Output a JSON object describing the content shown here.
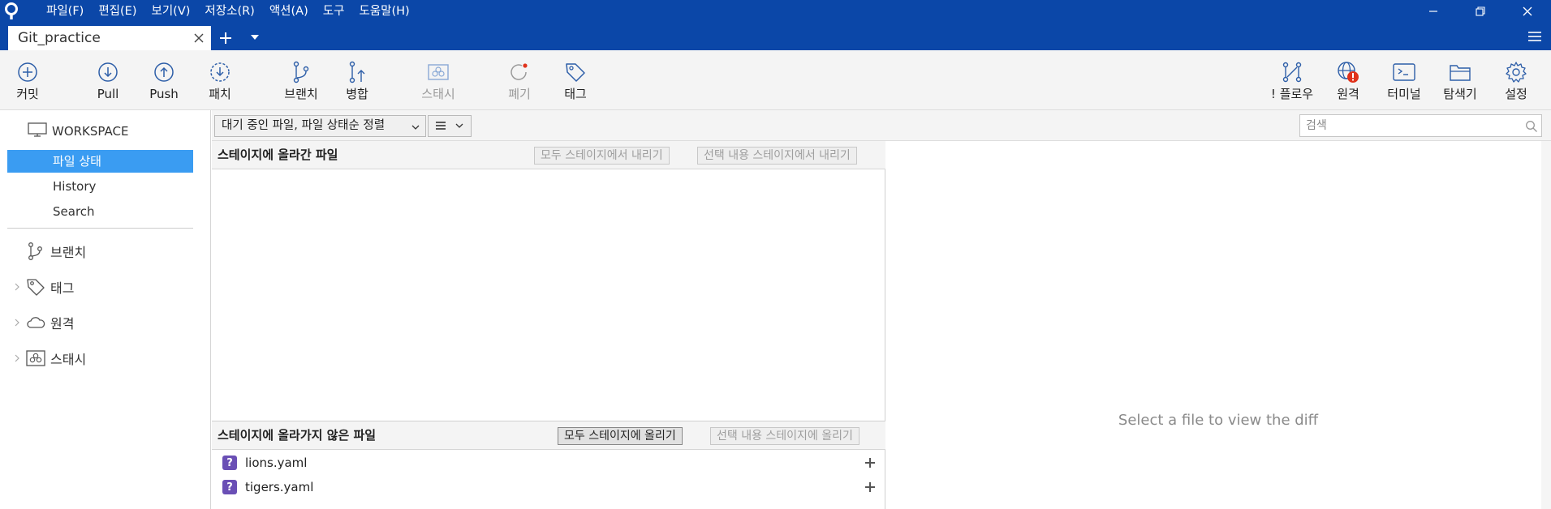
{
  "titlebar": {
    "menu": [
      "파일(F)",
      "편집(E)",
      "보기(V)",
      "저장소(R)",
      "액션(A)",
      "도구",
      "도움말(H)"
    ]
  },
  "tabs": {
    "active_label": "Git_practice"
  },
  "toolbar": {
    "commit": "커밋",
    "pull": "Pull",
    "push": "Push",
    "patch": "패치",
    "branch": "브랜치",
    "merge": "병합",
    "stash": "스태시",
    "discard": "폐기",
    "tag": "태그",
    "flow": "! 플로우",
    "remote": "원격",
    "terminal": "터미널",
    "explorer": "탐색기",
    "settings": "설정"
  },
  "sidebar": {
    "workspace": "WORKSPACE",
    "items": [
      "파일 상태",
      "History",
      "Search"
    ],
    "groups": [
      "브랜치",
      "태그",
      "원격",
      "스태시"
    ]
  },
  "filter": {
    "sort_label": "대기 중인 파일, 파일 상태순 정렬",
    "search_placeholder": "검색"
  },
  "staged": {
    "title": "스테이지에 올라간 파일",
    "unstage_all": "모두 스테이지에서 내리기",
    "unstage_selected": "선택 내용 스테이지에서 내리기"
  },
  "unstaged": {
    "title": "스테이지에 올라가지 않은 파일",
    "stage_all": "모두 스테이지에 올리기",
    "stage_selected": "선택 내용 스테이지에 올리기",
    "files": [
      {
        "status": "?",
        "name": "lions.yaml"
      },
      {
        "status": "?",
        "name": "tigers.yaml"
      }
    ]
  },
  "diff": {
    "empty_message": "Select a file to view the diff"
  },
  "colors": {
    "titlebar": "#0b47a8",
    "accent": "#3a9cf2",
    "untracked": "#6a4fb5",
    "alert": "#e0321b"
  }
}
